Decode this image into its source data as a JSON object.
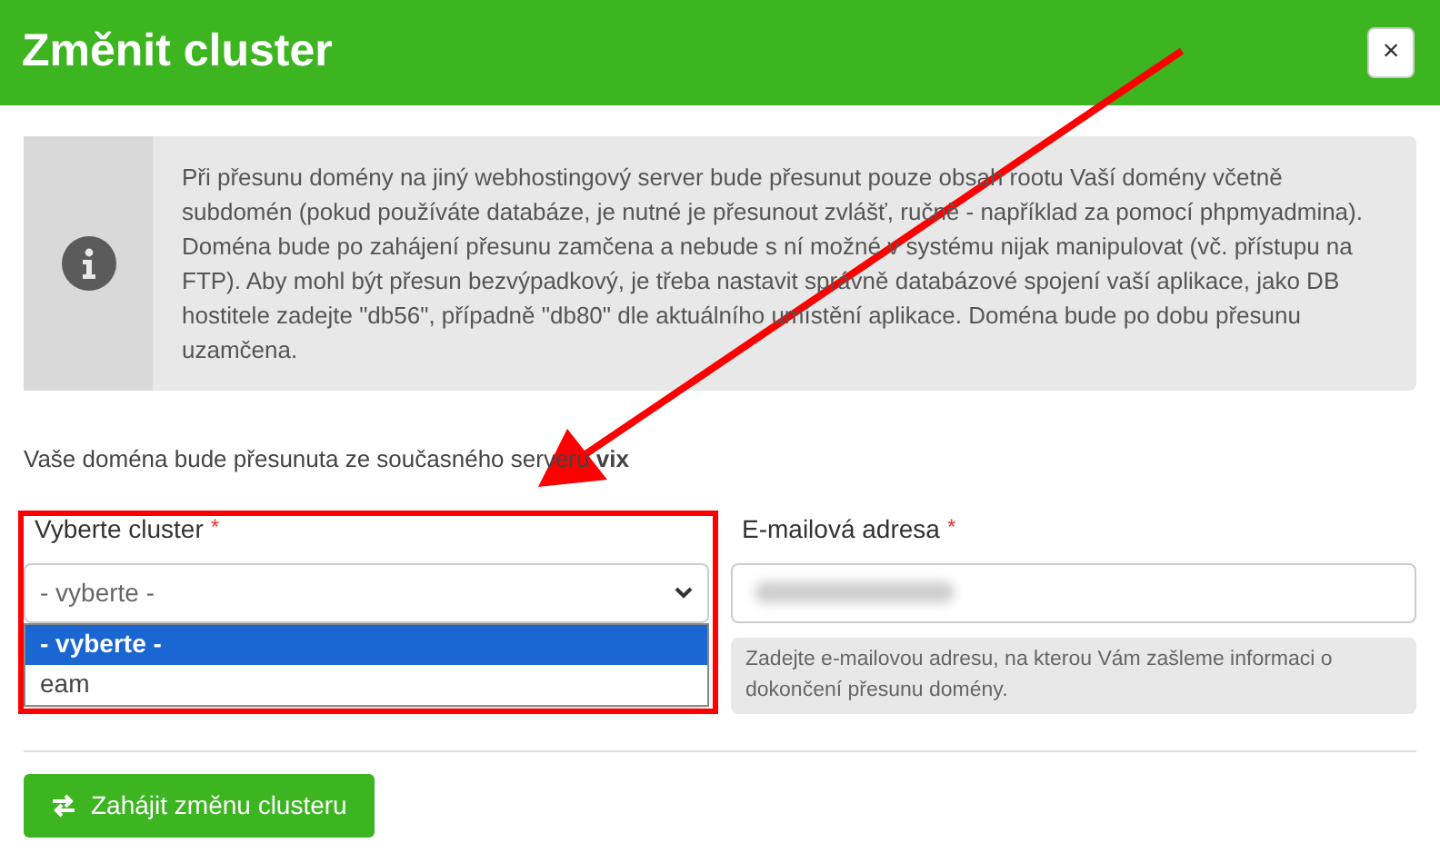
{
  "dialog": {
    "title": "Změnit cluster",
    "close": "×"
  },
  "info": {
    "text": "Při přesunu domény na jiný webhostingový server bude přesunut pouze obsah rootu Vaší domény včetně subdomén (pokud používáte databáze, je nutné je přesunout zvlášť, ručně - například za pomocí phpmyadmina). Doména bude po zahájení přesunu zamčena a nebude s ní možné v systému nijak manipulovat (vč. přístupu na FTP). Aby mohl být přesun bezvýpadkový, je třeba nastavit správně databázové spojení vaší aplikace, jako DB hostitele zadejte \"db56\", případně \"db80\" dle aktuálního umístění aplikace. Doména bude po dobu přesunu uzamčena."
  },
  "source_note": "Vaše doména bude přesunuta ze současného serveru **vix**",
  "cluster_field": {
    "label": "Vyberte cluster",
    "required_mark": "*",
    "value": "- vyberte -",
    "expanded": true,
    "options": [
      {
        "label": "- vyberte -",
        "selected": true
      },
      {
        "label": "eam",
        "selected": false
      }
    ]
  },
  "email_field": {
    "label": "E-mailová adresa",
    "required_mark": "*",
    "help": "Zadejte e-mailovou adresu, na kterou Vám zašleme informaci o dokončení přesunu domény."
  },
  "submit_button": "Zahájit změnu clusteru"
}
